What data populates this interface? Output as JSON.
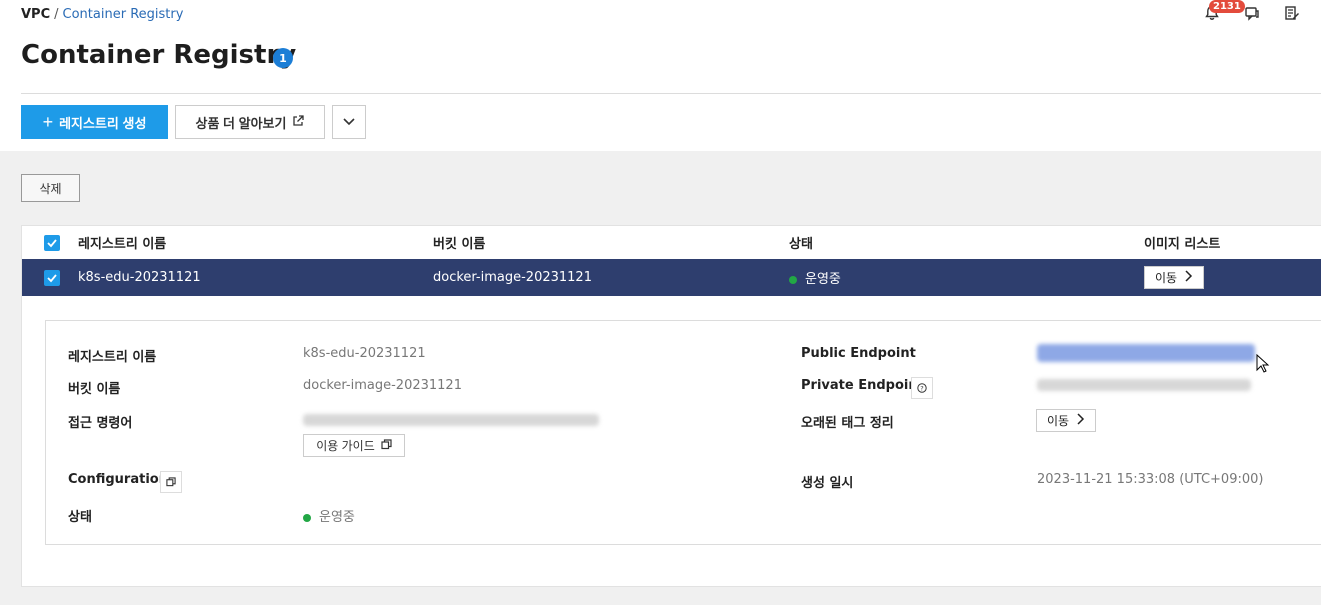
{
  "breadcrumb": {
    "root": "VPC",
    "sep": "/",
    "current": "Container Registry"
  },
  "header": {
    "notification_count": "2131"
  },
  "page": {
    "title": "Container Registry",
    "title_badge": "1"
  },
  "toolbar": {
    "create_label": "레지스트리 생성",
    "learn_more_label": "상품 더 알아보기",
    "delete_label": "삭제"
  },
  "table": {
    "columns": [
      "레지스트리 이름",
      "버킷 이름",
      "상태",
      "이미지 리스트"
    ],
    "row": {
      "name": "k8s-edu-20231121",
      "bucket": "docker-image-20231121",
      "status": "운영중",
      "action": "이동"
    }
  },
  "detail": {
    "labels": {
      "registry_name": "레지스트리 이름",
      "bucket_name": "버킷 이름",
      "access_command": "접근 명령어",
      "configuration": "Configuration",
      "status": "상태",
      "public_endpoint": "Public Endpoint",
      "private_endpoint": "Private Endpoint",
      "old_tag_cleanup": "오래된 태그 정리",
      "created_at": "생성 일시"
    },
    "values": {
      "registry_name": "k8s-edu-20231121",
      "bucket_name": "docker-image-20231121",
      "guide_label": "이용 가이드",
      "status": "운영중",
      "old_tag_action": "이동",
      "created_at": "2023-11-21 15:33:08 (UTC+09:00)"
    }
  },
  "colors": {
    "primary": "#1e9be8",
    "selected_row": "#2e3e6e",
    "status_green": "#22a745",
    "badge_red": "#e34b3c"
  }
}
